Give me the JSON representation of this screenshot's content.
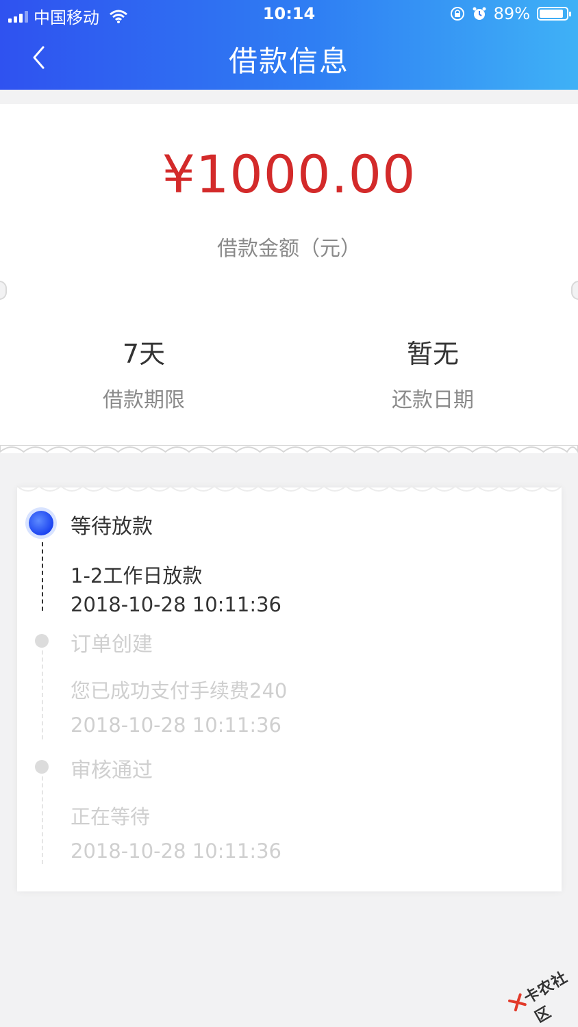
{
  "status_bar": {
    "carrier": "中国移动",
    "time": "10:14",
    "battery_pct": "89%",
    "battery_level": 0.89
  },
  "nav": {
    "title": "借款信息",
    "back_icon": "chevron-left-icon"
  },
  "loan": {
    "amount": "¥1000.00",
    "amount_label": "借款金额（元）",
    "term_value": "7天",
    "term_label": "借款期限",
    "repay_value": "暂无",
    "repay_label": "还款日期"
  },
  "timeline": [
    {
      "title": "等待放款",
      "desc": "1-2工作日放款",
      "time": "2018-10-28 10:11:36",
      "active": true
    },
    {
      "title": "订单创建",
      "desc": "您已成功支付手续费240",
      "time": "2018-10-28 10:11:36",
      "active": false
    },
    {
      "title": "审核通过",
      "desc": "正在等待",
      "time": "2018-10-28 10:11:36",
      "active": false
    }
  ],
  "watermark": "卡农社区",
  "colors": {
    "accent_red": "#d32a2a",
    "header_start": "#2f52f0",
    "header_end": "#3fb1f6",
    "active_dot": "#1c44f0"
  }
}
